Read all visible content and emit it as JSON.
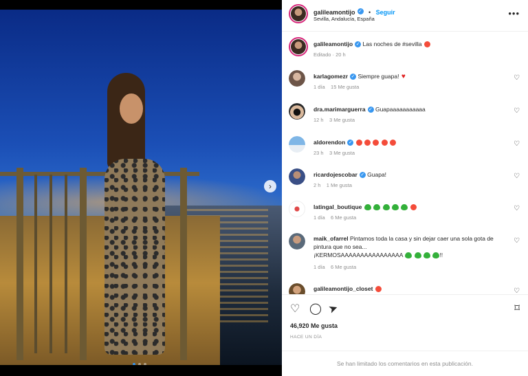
{
  "post": {
    "author": "galileamontijo",
    "follow_separator": "•",
    "follow_label": "Seguir",
    "location": "Sevilla, Andalucía, España",
    "more_icon": "more-horizontal-icon"
  },
  "caption": {
    "user": "galileamontijo",
    "text": "Las noches de #sevilla",
    "time": "Editado · 20 h"
  },
  "comments": [
    {
      "user": "karlagomezr",
      "text": "Siempre guapa!",
      "time": "1 día",
      "likes": "15 Me gusta"
    },
    {
      "user": "dra.marimarguerra",
      "text": "Guapaaaaaaaaaaa",
      "time": "12 h",
      "likes": "3 Me gusta"
    },
    {
      "user": "aldorendon",
      "text": "",
      "time": "23 h",
      "likes": "3 Me gusta"
    },
    {
      "user": "ricardojescobar",
      "text": "Guapa!",
      "time": "2 h",
      "likes": "1 Me gusta"
    },
    {
      "user": "latingal_boutique",
      "text": "",
      "time": "1 día",
      "likes": "6 Me gusta"
    },
    {
      "user": "maik_ofarrel",
      "text": "Pintamos toda la casa y sin dejar caer una sola gota de pintura que no sea...",
      "text2": "¡KERMOSAAAAAAAAAAAAAAAA",
      "text2_suffix": "!!",
      "time": "1 día",
      "likes": "6 Me gusta"
    },
    {
      "user": "galileamontijo_closet",
      "text": ""
    }
  ],
  "actions": {
    "likes_count": "46,920 Me gusta",
    "posted": "HACE UN DÍA"
  },
  "footer": {
    "limited_text": "Se han limitado los comentarios en esta publicación."
  },
  "colors": {
    "accent": "#0095f6",
    "verified": "#3897f0",
    "muted": "#8e8e8e"
  }
}
